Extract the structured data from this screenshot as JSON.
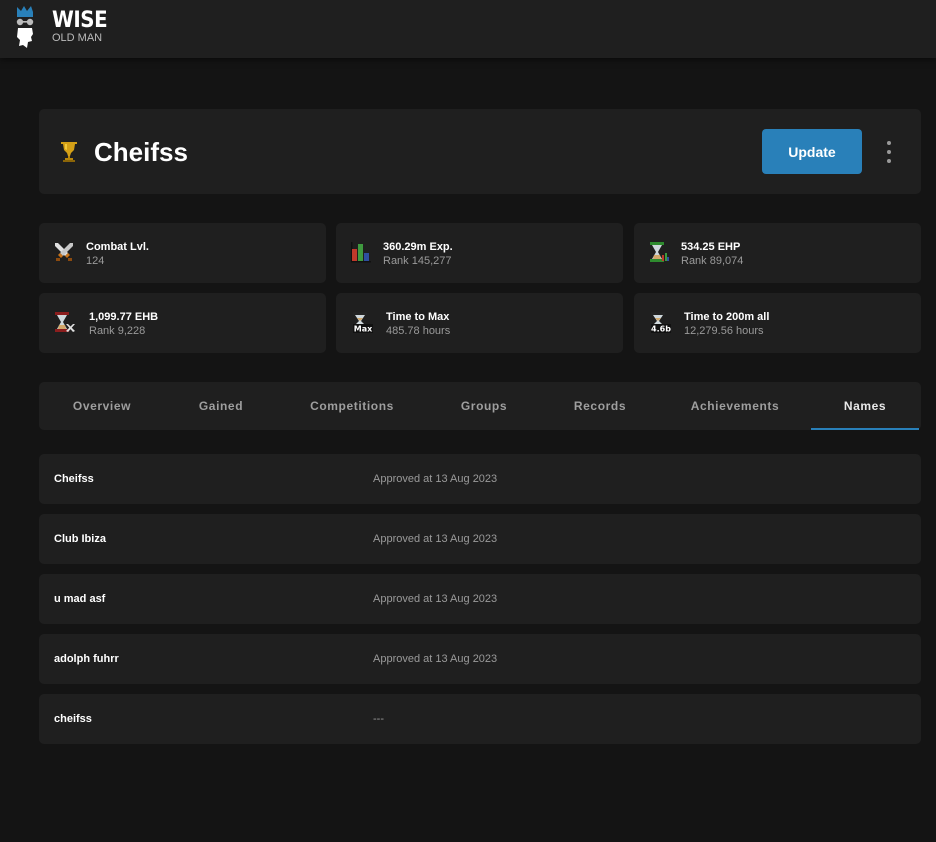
{
  "app": {
    "logo_title": "WISE",
    "logo_subtitle": "OLD MAN"
  },
  "player": {
    "name": "Cheifss",
    "update_label": "Update",
    "more_icon": "more-vertical-icon",
    "type_icon": "trophy-icon"
  },
  "stats": [
    {
      "icon": "combat-swords-icon",
      "title": "Combat Lvl.",
      "subtitle": "124"
    },
    {
      "icon": "exp-bar-chart-icon",
      "title": "360.29m Exp.",
      "subtitle": "Rank 145,277"
    },
    {
      "icon": "ehp-hourglass-icon",
      "title": "534.25 EHP",
      "subtitle": "Rank 89,074"
    },
    {
      "icon": "ehb-hourglass-icon",
      "title": "1,099.77 EHB",
      "subtitle": "Rank 9,228"
    },
    {
      "icon": "max-hourglass-icon",
      "icon_label": "Max",
      "title": "Time to Max",
      "subtitle": "485.78 hours"
    },
    {
      "icon": "200m-hourglass-icon",
      "icon_label": "4.6b",
      "title": "Time to 200m all",
      "subtitle": "12,279.56 hours"
    }
  ],
  "tabs": [
    {
      "label": "Overview",
      "active": false
    },
    {
      "label": "Gained",
      "active": false
    },
    {
      "label": "Competitions",
      "active": false
    },
    {
      "label": "Groups",
      "active": false
    },
    {
      "label": "Records",
      "active": false
    },
    {
      "label": "Achievements",
      "active": false
    },
    {
      "label": "Names",
      "active": true
    }
  ],
  "names": [
    {
      "name": "Cheifss",
      "status": "Approved at 13 Aug 2023"
    },
    {
      "name": "Club Ibiza",
      "status": "Approved at 13 Aug 2023"
    },
    {
      "name": "u mad asf",
      "status": "Approved at 13 Aug 2023"
    },
    {
      "name": "adolph fuhrr",
      "status": "Approved at 13 Aug 2023"
    },
    {
      "name": "cheifss",
      "status": "---"
    }
  ],
  "colors": {
    "accent": "#2980b9",
    "background": "#141414",
    "card": "#1f1f1f",
    "muted_text": "#9a9a9a"
  }
}
